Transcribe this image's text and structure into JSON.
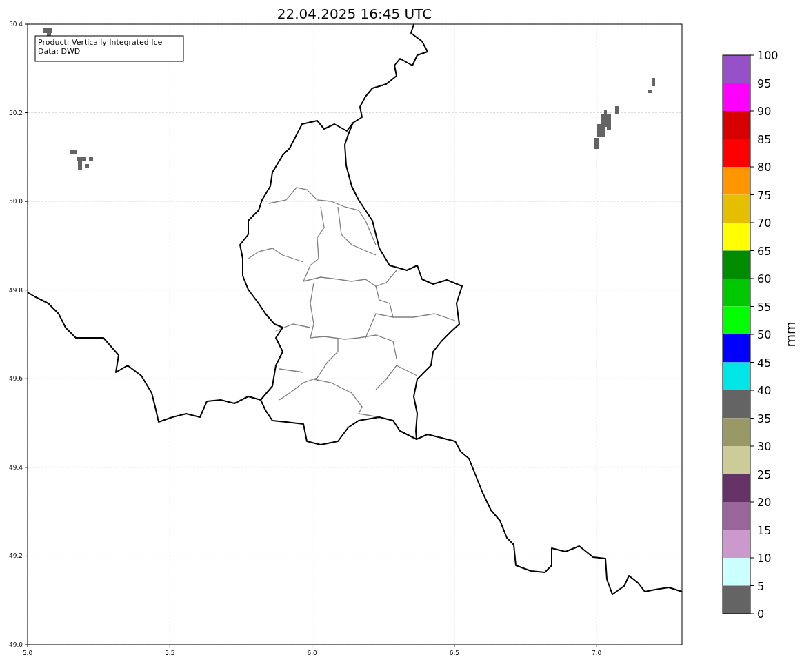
{
  "title": "22.04.2025 16:45 UTC",
  "map": {
    "xticks": [
      "5.0",
      "5.5",
      "6.0",
      "6.5",
      "7.0"
    ],
    "yticks": [
      "50.4",
      "50.2",
      "50.0",
      "49.8",
      "49.6",
      "49.4",
      "49.2",
      "49.0"
    ],
    "info_box": [
      "Product: Vertically Integrated Ice",
      "Data: DWD"
    ]
  },
  "colorbar": {
    "label": "mm",
    "ticks": [
      "100",
      "95",
      "90",
      "85",
      "80",
      "75",
      "70",
      "65",
      "60",
      "55",
      "50",
      "45",
      "40",
      "35",
      "30",
      "25",
      "20",
      "15",
      "10",
      "5",
      "0"
    ],
    "bins": [
      {
        "color": "#9650c8"
      },
      {
        "color": "#ff00ff"
      },
      {
        "color": "#d70000"
      },
      {
        "color": "#ff0000"
      },
      {
        "color": "#ff9600"
      },
      {
        "color": "#e6be00"
      },
      {
        "color": "#ffff00"
      },
      {
        "color": "#008c00"
      },
      {
        "color": "#00c800"
      },
      {
        "color": "#00ff00"
      },
      {
        "color": "#0000ff"
      },
      {
        "color": "#00e6e6"
      },
      {
        "color": "#646464"
      },
      {
        "color": "#999966"
      },
      {
        "color": "#cccc99"
      },
      {
        "color": "#663366"
      },
      {
        "color": "#996699"
      },
      {
        "color": "#cc99cc"
      },
      {
        "color": "#ccffff"
      },
      {
        "color": "#646464"
      }
    ]
  }
}
